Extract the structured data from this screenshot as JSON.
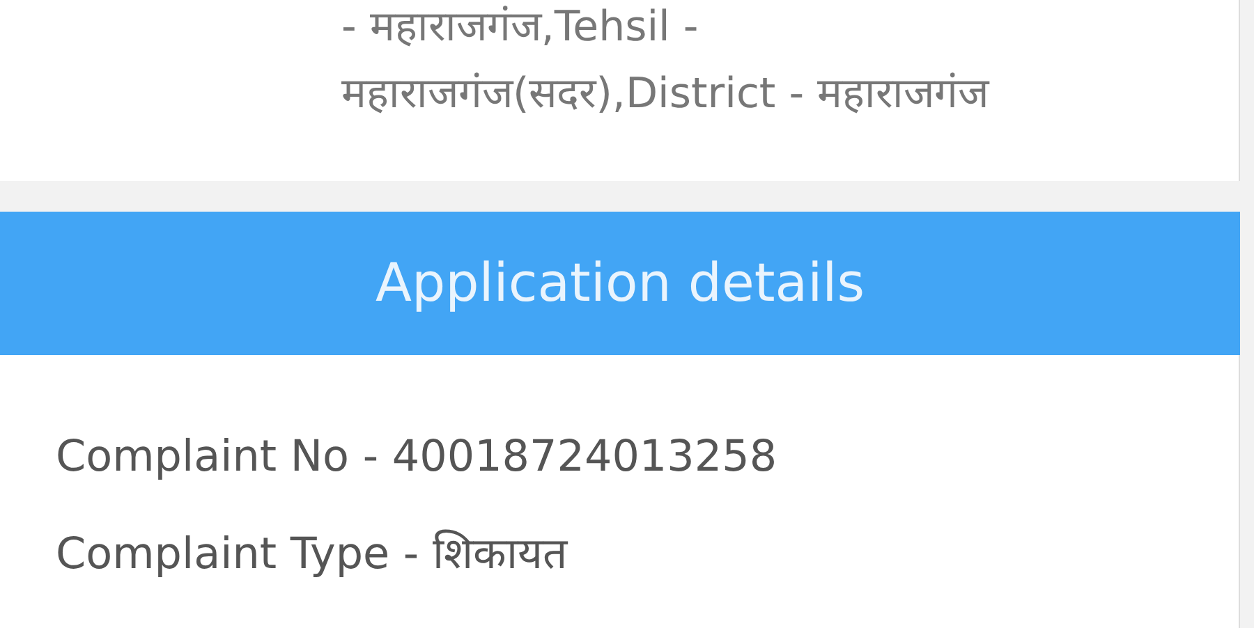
{
  "address_lines": [
    "- महाराजगंज,Tehsil -",
    "महाराजगंज(सदर),District - महाराजगंज"
  ],
  "section": {
    "title": "Application details"
  },
  "details": [
    "Complaint No - 40018724013258",
    "Complaint Type - शिकायत"
  ]
}
